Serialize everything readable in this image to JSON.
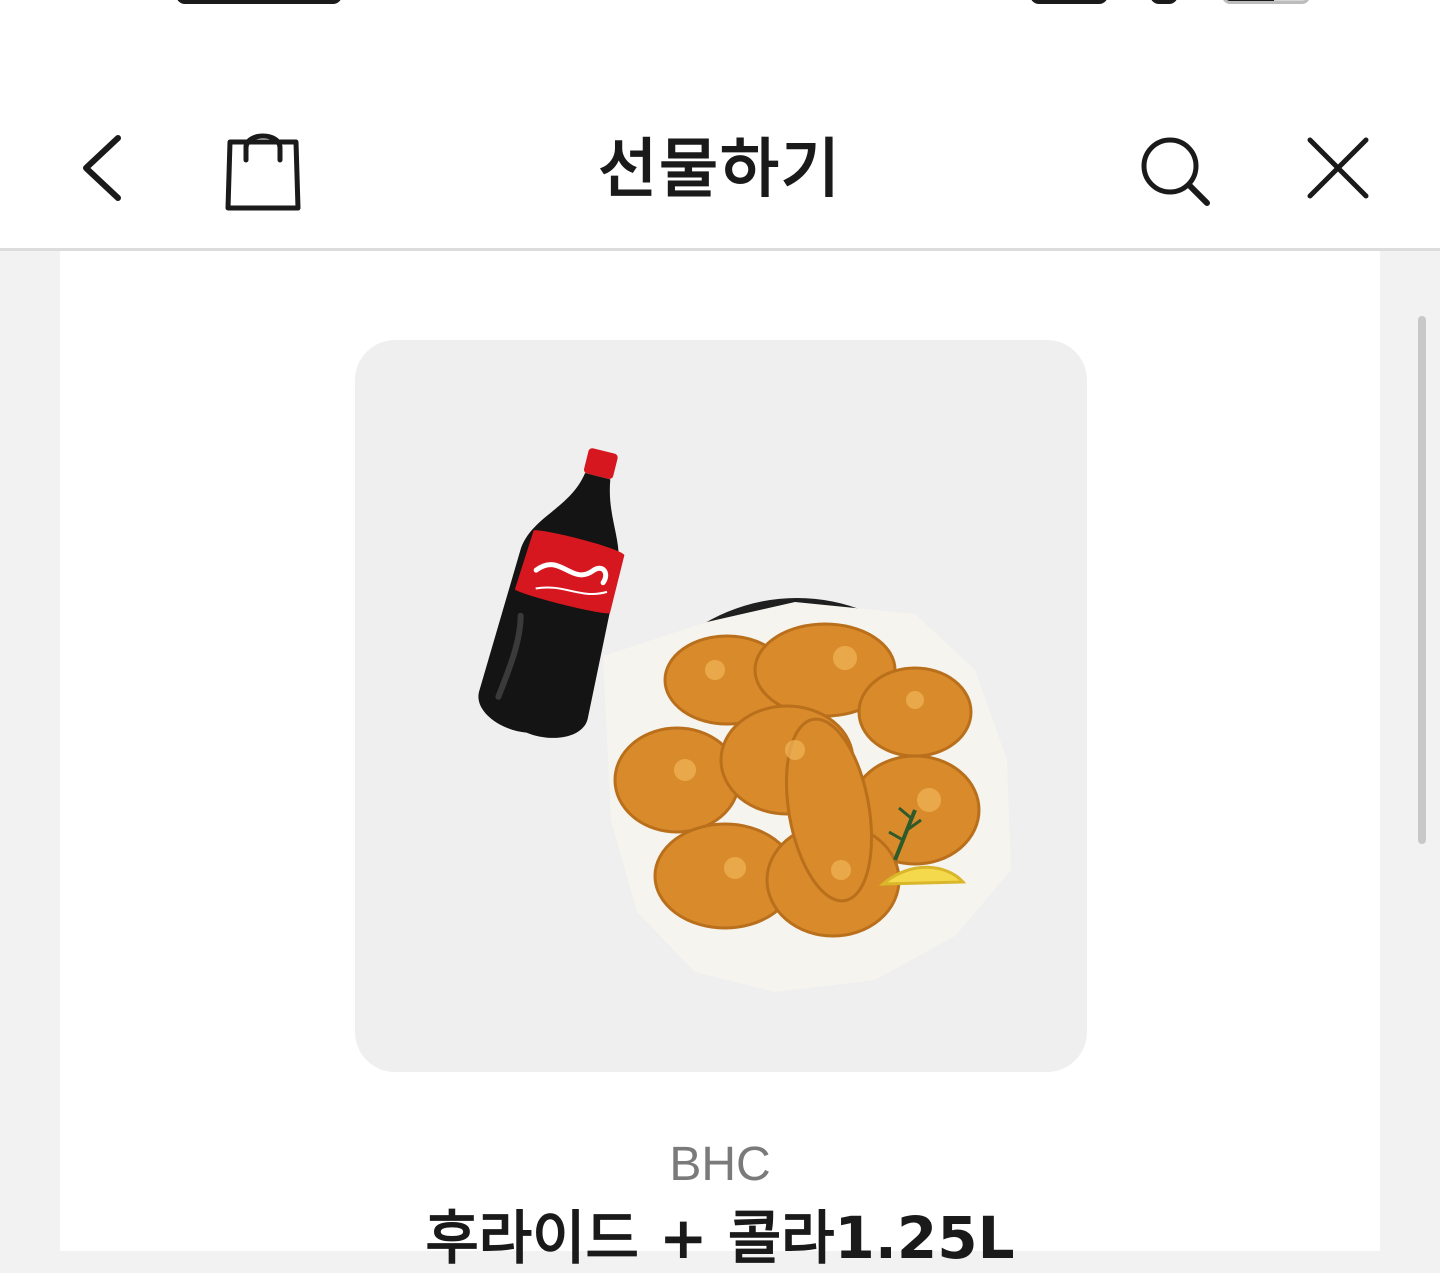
{
  "nav": {
    "title": "선물하기",
    "back_icon": "chevron-left-icon",
    "bag_icon": "shopping-bag-icon",
    "search_icon": "search-icon",
    "close_icon": "close-icon"
  },
  "product": {
    "brand": "BHC",
    "name": "후라이드 + 콜라1.25L",
    "image_icon": "fried-chicken-and-cola-image"
  },
  "colors": {
    "text_primary": "#1a1a1a",
    "text_secondary": "#7a7a7a",
    "page_background": "#f2f2f2",
    "image_background": "#efefef",
    "cola_red": "#d6171f"
  }
}
